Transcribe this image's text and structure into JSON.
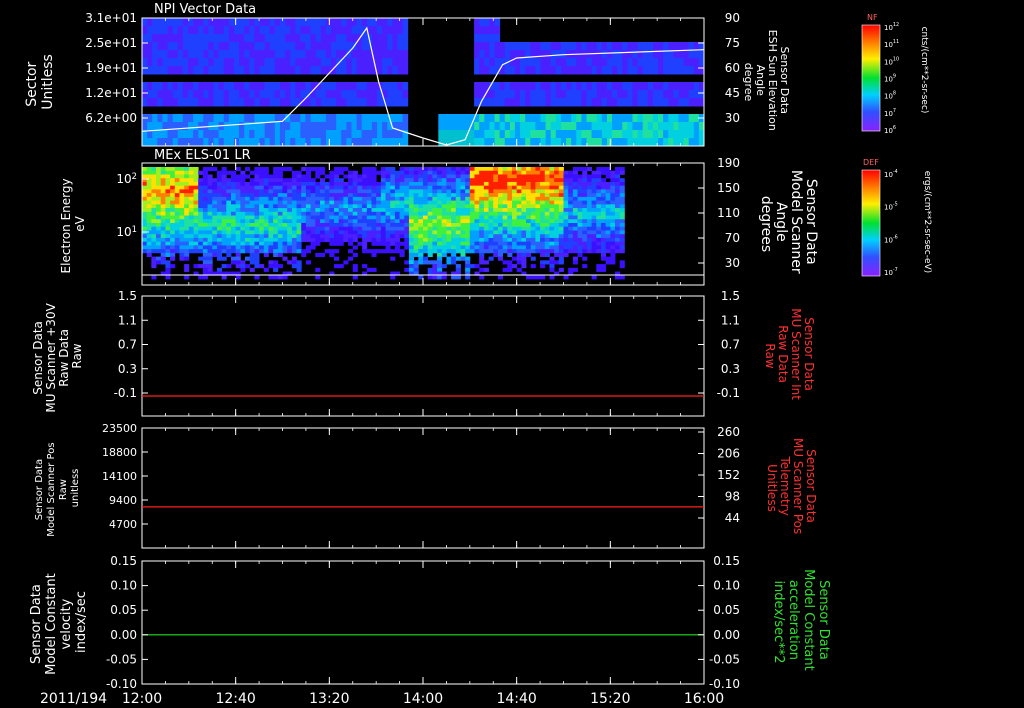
{
  "colors": {
    "background": "#000000",
    "axis": "#ffffff",
    "red_trace": "#ff2020",
    "green_trace": "#20e020",
    "red_label": "#ff3030",
    "green_label": "#30e030"
  },
  "time_axis": {
    "date_label": "2011/194",
    "ticks": [
      "12:00",
      "12:40",
      "13:20",
      "14:00",
      "14:40",
      "15:20",
      "16:00"
    ]
  },
  "chart_data": [
    {
      "type": "heatmap",
      "title": "NPI Vector Data",
      "ylabel_lines": [
        "Sector",
        "Unitless"
      ],
      "yticks": [
        "3.1e+01",
        "2.5e+01",
        "1.9e+01",
        "1.2e+01",
        "6.2e+00"
      ],
      "right_label_lines": [
        "Sensor Data",
        "ESH Sun Elevation",
        "Angle",
        "degree"
      ],
      "right_ticks": [
        "90",
        "75",
        "60",
        "45",
        "30"
      ],
      "overlay_line": {
        "x": [
          "12:00",
          "12:40",
          "13:00",
          "13:10",
          "13:30",
          "13:36",
          "13:41",
          "13:47",
          "14:00",
          "14:10",
          "14:18",
          "14:25",
          "14:34",
          "14:40",
          "15:00",
          "16:00"
        ],
        "y": [
          22,
          26,
          28,
          42,
          72,
          84,
          52,
          24,
          18,
          12,
          17,
          40,
          62,
          66,
          68,
          71
        ]
      },
      "colorbar": {
        "title": "NF",
        "label": "cnts/(cm**2-sr-sec)",
        "ticks": [
          "10^12",
          "10^11",
          "10^10",
          "10^9",
          "10^8",
          "10^7",
          "10^6"
        ]
      }
    },
    {
      "type": "heatmap",
      "title": "MEx ELS-01 LR",
      "ylabel_lines": [
        "Electron Energy",
        "eV"
      ],
      "yticks": [
        "10^2",
        "10^1"
      ],
      "right_label_lines": [
        "Sensor Data",
        "Model Scanner",
        "Angle",
        "degrees"
      ],
      "right_ticks": [
        "190",
        "150",
        "110",
        "70",
        "30"
      ],
      "overlay_line": {
        "x": [
          "12:00",
          "16:00"
        ],
        "y": [
          10,
          10
        ]
      },
      "colorbar": {
        "title": "DEF",
        "label": "ergs/(cm**2-sr-sec-eV)",
        "ticks": [
          "10^-4",
          "10^-5",
          "10^-6",
          "10^-7"
        ]
      }
    },
    {
      "type": "line",
      "ylabel_lines": [
        "Sensor Data",
        "MU Scanner +30V",
        "Raw Data",
        "Raw"
      ],
      "yticks": [
        "1.5",
        "1.1",
        "0.7",
        "0.3",
        "-0.1"
      ],
      "ylim": [
        -0.3,
        1.5
      ],
      "right_label_lines": [
        "Sensor Data",
        "MU Scanner Int",
        "Raw Data",
        "Raw"
      ],
      "right_ticks": [
        "1.5",
        "1.1",
        "0.7",
        "0.3",
        "-0.1"
      ],
      "series": [
        {
          "x": [
            "12:00",
            "16:00"
          ],
          "values": [
            0.0,
            0.0
          ],
          "color": "#ff2020"
        }
      ]
    },
    {
      "type": "line",
      "ylabel_lines": [
        "Sensor Data",
        "Model Scanner Pos",
        "Raw",
        "unitless"
      ],
      "yticks": [
        "23500",
        "18800",
        "14100",
        "9400",
        "4700"
      ],
      "ylim": [
        0,
        23500
      ],
      "right_label_lines": [
        "Sensor Data",
        "MU Scanner Pos",
        "Telemetry",
        "Unitless"
      ],
      "right_ticks": [
        "260",
        "206",
        "152",
        "98",
        "44"
      ],
      "series": [
        {
          "x": [
            "12:00",
            "16:00"
          ],
          "values": [
            8050,
            8050
          ],
          "color": "#ff2020"
        }
      ]
    },
    {
      "type": "line",
      "ylabel_lines": [
        "Sensor Data",
        "Model Constant",
        "velocity",
        "index/sec"
      ],
      "yticks": [
        "0.15",
        "0.10",
        "0.05",
        "0.00",
        "-0.05",
        "-0.10"
      ],
      "ylim": [
        -0.1,
        0.15
      ],
      "right_label_lines": [
        "Sensor Data",
        "Model Constant",
        "acceleration",
        "index/sec**2"
      ],
      "right_ticks": [
        "0.15",
        "0.10",
        "0.05",
        "0.00",
        "-0.05",
        "-0.10"
      ],
      "series": [
        {
          "x": [
            "12:00",
            "16:00"
          ],
          "values": [
            0.0,
            0.0
          ],
          "color": "#20e020"
        }
      ]
    }
  ]
}
